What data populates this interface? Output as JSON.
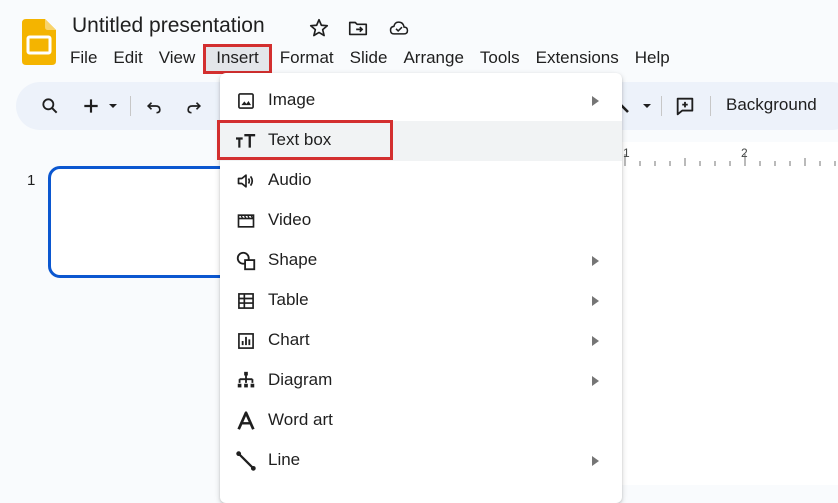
{
  "app": {
    "document_title": "Untitled presentation"
  },
  "menubar": {
    "items": [
      "File",
      "Edit",
      "View",
      "Insert",
      "Format",
      "Slide",
      "Arrange",
      "Tools",
      "Extensions",
      "Help"
    ]
  },
  "toolbar": {
    "background_label": "Background"
  },
  "filmstrip": {
    "slide_number": "1"
  },
  "ruler": {
    "labels": [
      "1",
      "2"
    ]
  },
  "insert_menu": {
    "items": [
      {
        "label": "Image",
        "icon": "image-icon",
        "submenu": true
      },
      {
        "label": "Text box",
        "icon": "text-box-icon",
        "submenu": false
      },
      {
        "label": "Audio",
        "icon": "audio-icon",
        "submenu": false
      },
      {
        "label": "Video",
        "icon": "video-icon",
        "submenu": false
      },
      {
        "label": "Shape",
        "icon": "shape-icon",
        "submenu": true
      },
      {
        "label": "Table",
        "icon": "table-icon",
        "submenu": true
      },
      {
        "label": "Chart",
        "icon": "chart-icon",
        "submenu": true
      },
      {
        "label": "Diagram",
        "icon": "diagram-icon",
        "submenu": true
      },
      {
        "label": "Word art",
        "icon": "word-art-icon",
        "submenu": false
      },
      {
        "label": "Line",
        "icon": "line-icon",
        "submenu": true
      }
    ]
  },
  "colors": {
    "accent_blue": "#0b57d0",
    "highlight_red": "#d32f2f",
    "logo_yellow": "#f4b400",
    "toolbar_bg": "#edf2fa"
  }
}
